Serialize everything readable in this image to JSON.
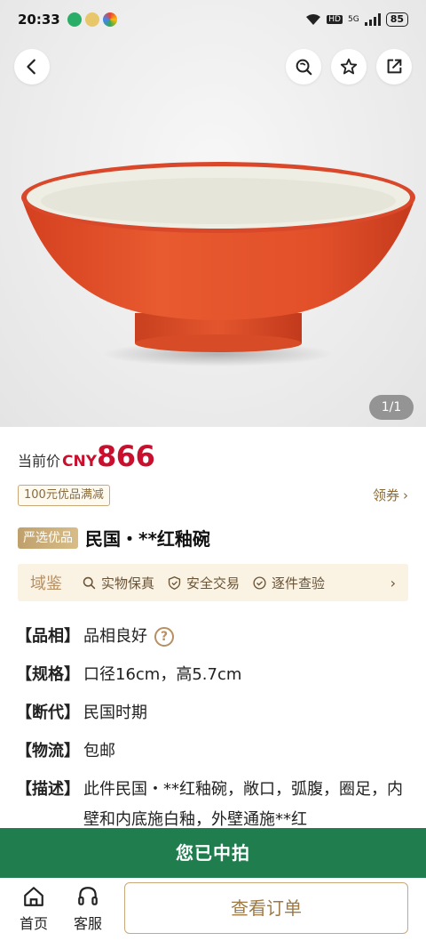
{
  "status_bar": {
    "time": "20:33",
    "hd": "HD",
    "network": "5G",
    "battery": "85"
  },
  "gallery": {
    "counter": "1/1"
  },
  "price": {
    "label": "当前价",
    "currency": "CNY",
    "value": "866"
  },
  "coupon": {
    "text": "100元优品满减",
    "claim_label": "领券",
    "claim_arrow": "›"
  },
  "item": {
    "badge": "严选优品",
    "title": "民国・**红釉碗"
  },
  "assurance": {
    "brand": "域鉴",
    "items": [
      "实物保真",
      "安全交易",
      "逐件查验"
    ],
    "arrow": "›"
  },
  "specs": [
    {
      "key": "【品相】",
      "value": "品相良好",
      "help": "?"
    },
    {
      "key": "【规格】",
      "value": "口径16cm，高5.7cm"
    },
    {
      "key": "【断代】",
      "value": "民国时期"
    },
    {
      "key": "【物流】",
      "value": "包邮"
    },
    {
      "key": "【描述】",
      "value": "此件民国・**红釉碗，敞口，弧腹，圈足，内壁和内底施白釉，外壁通施**红"
    }
  ],
  "banner": {
    "text": "您已中拍"
  },
  "bottom_bar": {
    "home_label": "首页",
    "service_label": "客服",
    "order_button": "查看订单"
  },
  "colors": {
    "price_red": "#c8102e",
    "gold": "#b69063",
    "banner_green": "#1f7d4e",
    "assurance_bg": "#faf2e3"
  }
}
